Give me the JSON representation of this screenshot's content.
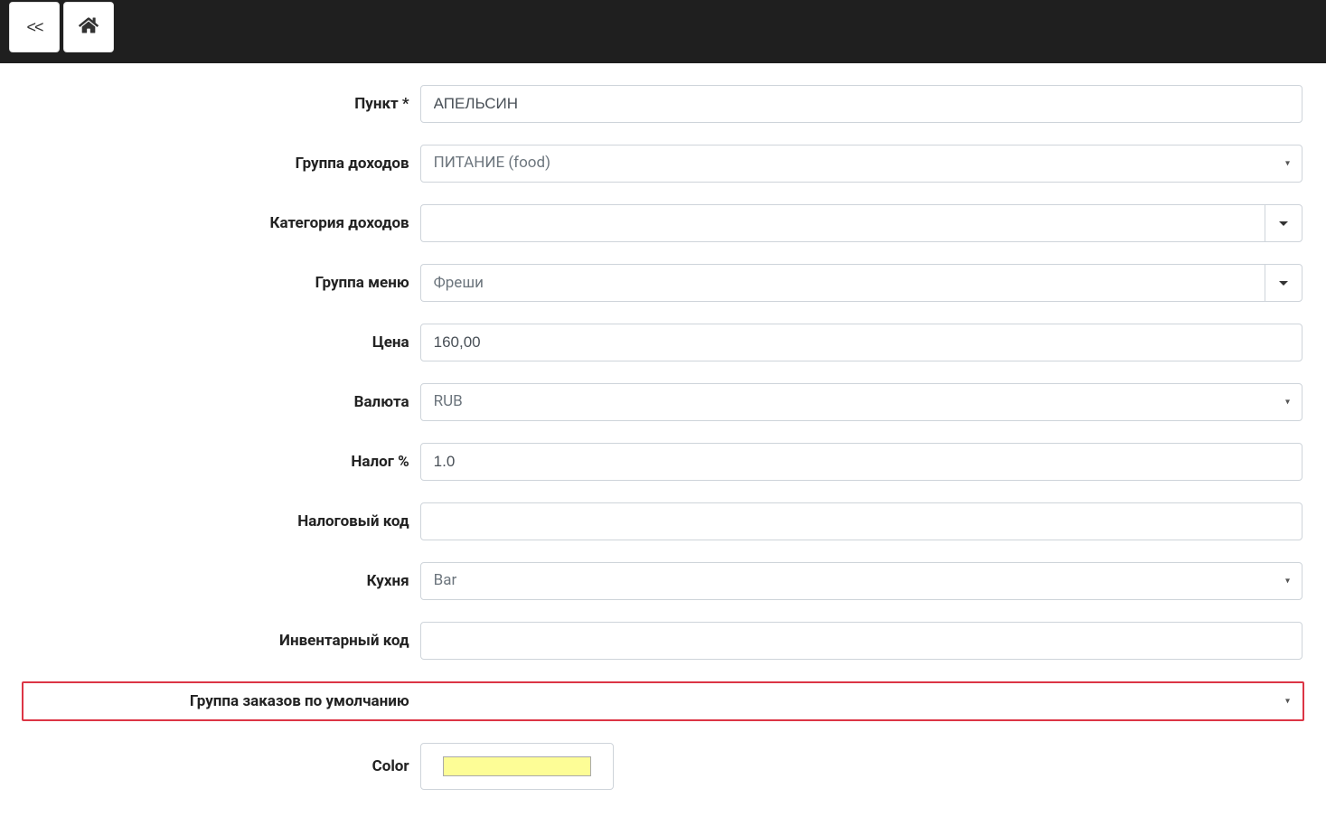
{
  "topbar": {
    "back_label": "<<"
  },
  "form": {
    "item": {
      "label": "Пункт *",
      "value": "АПЕЛЬСИН"
    },
    "revenue_group": {
      "label": "Группа доходов",
      "value": "ПИТАНИЕ (food)"
    },
    "revenue_category": {
      "label": "Категория доходов",
      "value": ""
    },
    "menu_group": {
      "label": "Группа меню",
      "value": "Фреши"
    },
    "price": {
      "label": "Цена",
      "value": "160,00"
    },
    "currency": {
      "label": "Валюта",
      "value": "RUB"
    },
    "tax_percent": {
      "label": "Налог %",
      "value": "1.0"
    },
    "tax_code": {
      "label": "Налоговый код",
      "value": ""
    },
    "kitchen": {
      "label": "Кухня",
      "value": "Bar"
    },
    "inventory_code": {
      "label": "Инвентарный код",
      "value": ""
    },
    "default_order_group": {
      "label": "Группа заказов по умолчанию",
      "value": ""
    },
    "color": {
      "label": "Color",
      "value": "#fdfd96"
    }
  }
}
